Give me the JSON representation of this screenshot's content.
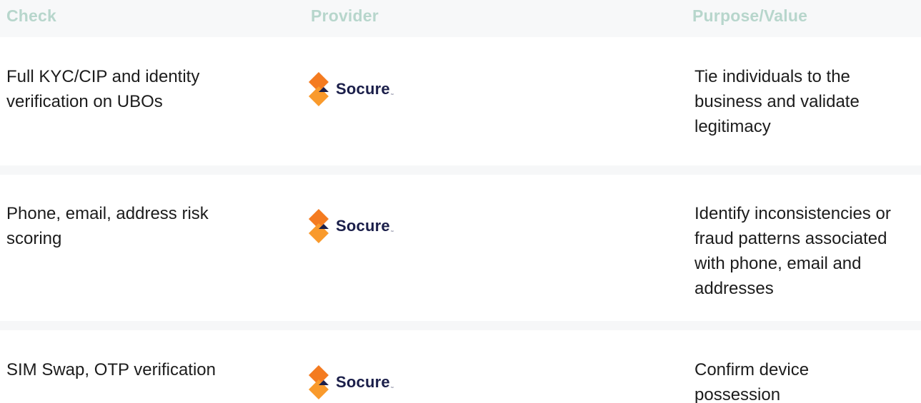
{
  "header": {
    "check": "Check",
    "provider": "Provider",
    "purpose": "Purpose/Value"
  },
  "rows": [
    {
      "check": [
        "Full KYC/CIP and identity",
        "verification on UBOs"
      ],
      "provider": "Socure",
      "purpose": [
        "Tie individuals to the",
        "business and validate",
        "legitimacy"
      ]
    },
    {
      "check": [
        "Phone, email, address risk",
        "scoring"
      ],
      "provider": "Socure",
      "purpose": [
        "Identify inconsistencies or",
        "fraud patterns associated",
        "with phone, email and",
        "addresses"
      ]
    },
    {
      "check": [
        "SIM Swap, OTP verification"
      ],
      "provider": "Socure",
      "purpose": [
        "Confirm device",
        "possession"
      ]
    }
  ],
  "logo": {
    "trademark": "™",
    "icon": "socure-logo-icon",
    "colors": {
      "orange": "#f47b20",
      "orange_light": "#f99a2c",
      "navy": "#1b1f4a"
    }
  }
}
